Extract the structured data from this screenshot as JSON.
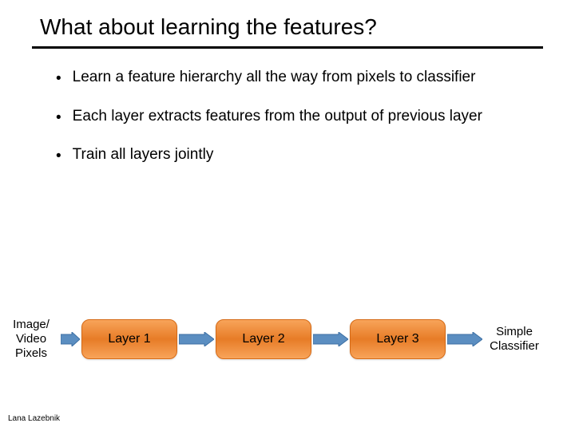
{
  "title": "What about learning the features?",
  "bullets": [
    "Learn a feature hierarchy all the way from pixels to classifier",
    "Each layer extracts features from the output of previous layer",
    "Train all layers jointly"
  ],
  "diagram": {
    "input": "Image/\nVideo\nPixels",
    "layers": [
      "Layer 1",
      "Layer 2",
      "Layer 3"
    ],
    "output": "Simple\nClassifier"
  },
  "credit": "Lana Lazebnik"
}
